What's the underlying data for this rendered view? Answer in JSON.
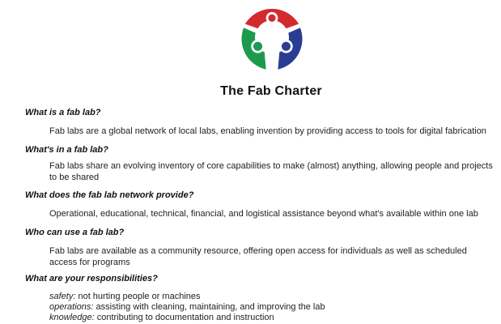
{
  "header": {
    "title": "The Fab Charter"
  },
  "logo": {
    "colors": {
      "red": "#d42a2e",
      "green": "#1d9a4e",
      "blue": "#2b3d93"
    }
  },
  "sections": [
    {
      "question": "What is a fab lab?",
      "answer": "Fab labs are a global network of local labs, enabling invention by providing access to tools for digital fabrication"
    },
    {
      "question": "What's in a fab lab?",
      "answer": "Fab labs share an evolving inventory of core capabilities to make (almost) anything, allowing people and projects to be shared"
    },
    {
      "question": "What does the fab lab network provide?",
      "answer": "Operational, educational, technical, financial, and logistical assistance beyond what's available within one lab"
    },
    {
      "question": "Who can use a fab lab?",
      "answer": "Fab labs are available as a community resource, offering open access for individuals as well as scheduled access for programs"
    },
    {
      "question": "What are your responsibilities?",
      "items": [
        {
          "term": "safety:",
          "text": " not hurting people or machines"
        },
        {
          "term": "operations:",
          "text": " assisting with cleaning, maintaining, and improving the lab"
        },
        {
          "term": "knowledge:",
          "text": " contributing to documentation and instruction"
        }
      ]
    }
  ]
}
